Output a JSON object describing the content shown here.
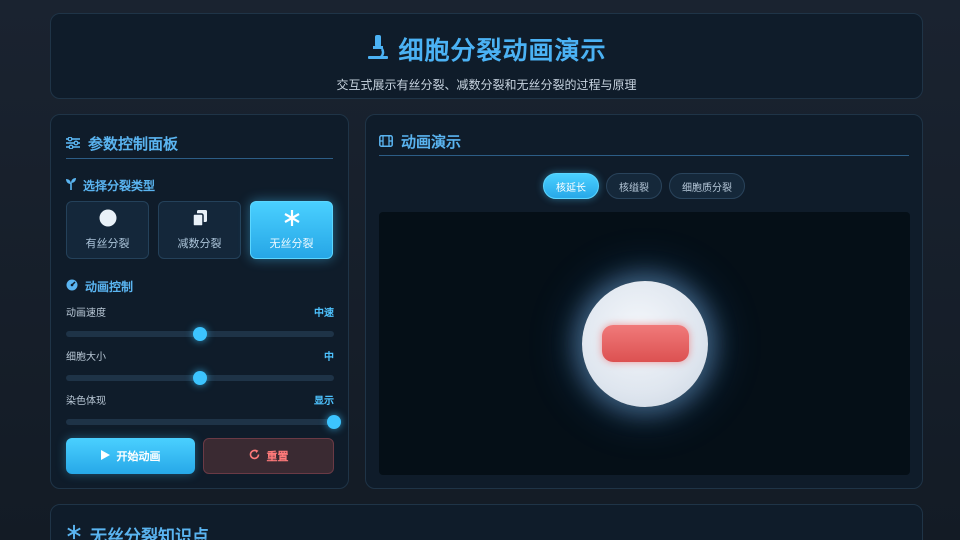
{
  "header": {
    "title": "细胞分裂动画演示",
    "subtitle": "交互式展示有丝分裂、减数分裂和无丝分裂的过程与原理",
    "icon": "microscope-icon"
  },
  "control_panel": {
    "title": "参数控制面板",
    "division_type": {
      "label": "选择分裂类型",
      "options": [
        {
          "label": "有丝分裂",
          "icon": "circle-icon",
          "active": false
        },
        {
          "label": "减数分裂",
          "icon": "copy-icon",
          "active": false
        },
        {
          "label": "无丝分裂",
          "icon": "asterisk-icon",
          "active": true
        }
      ]
    },
    "animation_control": {
      "label": "动画控制",
      "sliders": [
        {
          "label": "动画速度",
          "value": "中速",
          "level": 0.5
        },
        {
          "label": "细胞大小",
          "value": "中",
          "level": 0.5
        },
        {
          "label": "染色体现",
          "value": "显示",
          "level": 1.0
        }
      ]
    },
    "buttons": {
      "start": "开始动画",
      "reset": "重置"
    }
  },
  "animation_panel": {
    "title": "动画演示",
    "tabs": [
      {
        "label": "核延长",
        "active": true
      },
      {
        "label": "核缢裂",
        "active": false
      },
      {
        "label": "细胞质分裂",
        "active": false
      }
    ]
  },
  "knowledge": {
    "title": "无丝分裂知识点"
  },
  "colors": {
    "accent": "#4bb2f4",
    "active_button": "#3cc4ff",
    "reset": "#ff7a7a",
    "chromosome": "#e05a5a"
  }
}
